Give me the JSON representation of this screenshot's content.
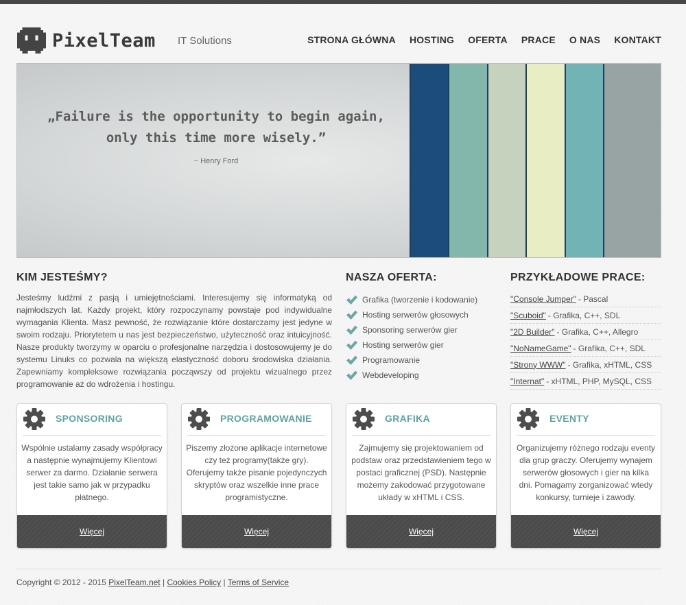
{
  "header": {
    "brand": "PixelTeam",
    "tagline": "IT Solutions",
    "nav": [
      "STRONA GŁÓWNA",
      "HOSTING",
      "OFERTA",
      "PRACE",
      "O NAS",
      "KONTAKT"
    ]
  },
  "hero": {
    "quote": "„Failure is the opportunity to begin again, only this time more wisely.”",
    "author": "~ Henry Ford",
    "stripe_colors": [
      "#1b4c7c",
      "#83b7ac",
      "#c5d2bd",
      "#e9edc4",
      "#72b3b5",
      "#98a4a3"
    ]
  },
  "about": {
    "heading": "KIM JESTEŚMY?",
    "text": "Jesteśmy ludźmi z pasją i umiejętnościami. Interesujemy się informatyką od najmłodszych lat. Każdy projekt, który rozpoczynamy powstaje pod indywidualne wymagania Klienta. Masz pewność, że rozwiązanie które dostarczamy jest jedyne w swoim rodzaju. Priorytetem u nas jest bezpieczeństwo, użyteczność oraz intuicyjność. Nasze produkty tworzymy w oparciu o profesjonalne narzędzia i dostosowujemy je do systemu Linuks co pozwala na większą elastyczność doboru środowiska działania. Zapewniamy kompleksowe rozwiązania począwszy od projektu wizualnego przez programowanie aż do wdrożenia i hostingu."
  },
  "offer": {
    "heading": "NASZA OFERTA:",
    "items": [
      "Grafika (tworzenie i kodowanie)",
      "Hosting serwerów głosowych",
      "Sponsoring serwerów gier",
      "Hosting serwerów gier",
      "Programowanie",
      "Webdeveloping"
    ]
  },
  "works": {
    "heading": "PRZYKŁADOWE PRACE:",
    "items": [
      {
        "name": "\"Console Jumper\"",
        "tech": "- Pascal"
      },
      {
        "name": "\"Scuboid\"",
        "tech": "- Grafika, C++, SDL"
      },
      {
        "name": "\"2D Builder\"",
        "tech": "- Grafika, C++, Allegro"
      },
      {
        "name": "\"NoNameGame\"",
        "tech": "- Grafika, C++, SDL"
      },
      {
        "name": "\"Strony WWW\"",
        "tech": "- Grafika, xHTML, CSS"
      },
      {
        "name": "\"Internat\"",
        "tech": "- xHTML, PHP, MySQL, CSS"
      }
    ]
  },
  "boxes": [
    {
      "title": "SPONSORING",
      "text": "Wspólnie ustalamy zasady współpracy a następnie wynajmujemy Klientowi serwer za darmo. Działanie serwera jest takie samo jak w przypadku płatnego.",
      "link": "Więcej"
    },
    {
      "title": "PROGRAMOWANIE",
      "text": "Piszemy złożone aplikacje internetowe czy też programy(także gry). Oferujemy także pisanie pojedynczych skryptów oraz wszelkie inne prace programistyczne.",
      "link": "Więcej"
    },
    {
      "title": "GRAFIKA",
      "text": "Zajmujemy się projektowaniem od podstaw oraz przedstawieniem tego w postaci graficznej (PSD). Następnie możemy zakodować przygotowane układy w xHTML i CSS.",
      "link": "Więcej"
    },
    {
      "title": "EVENTY",
      "text": "Organizujemy różnego rodzaju eventy dla grup graczy. Oferujemy wynajem serwerów głosowych i gier na kilka dni. Pomagamy zorganizować wtedy konkursy, turnieje i zawody.",
      "link": "Więcej"
    }
  ],
  "footer": {
    "copyright": "Copyright © 2012 - 2015",
    "site_link": "PixelTeam.net",
    "separator": "|",
    "cookies": "Cookies Policy",
    "terms": "Terms of Service"
  },
  "colors": {
    "accent": "#5fa2a2",
    "check": "#6aa7a5",
    "dark_band": "#4a4a4a"
  }
}
